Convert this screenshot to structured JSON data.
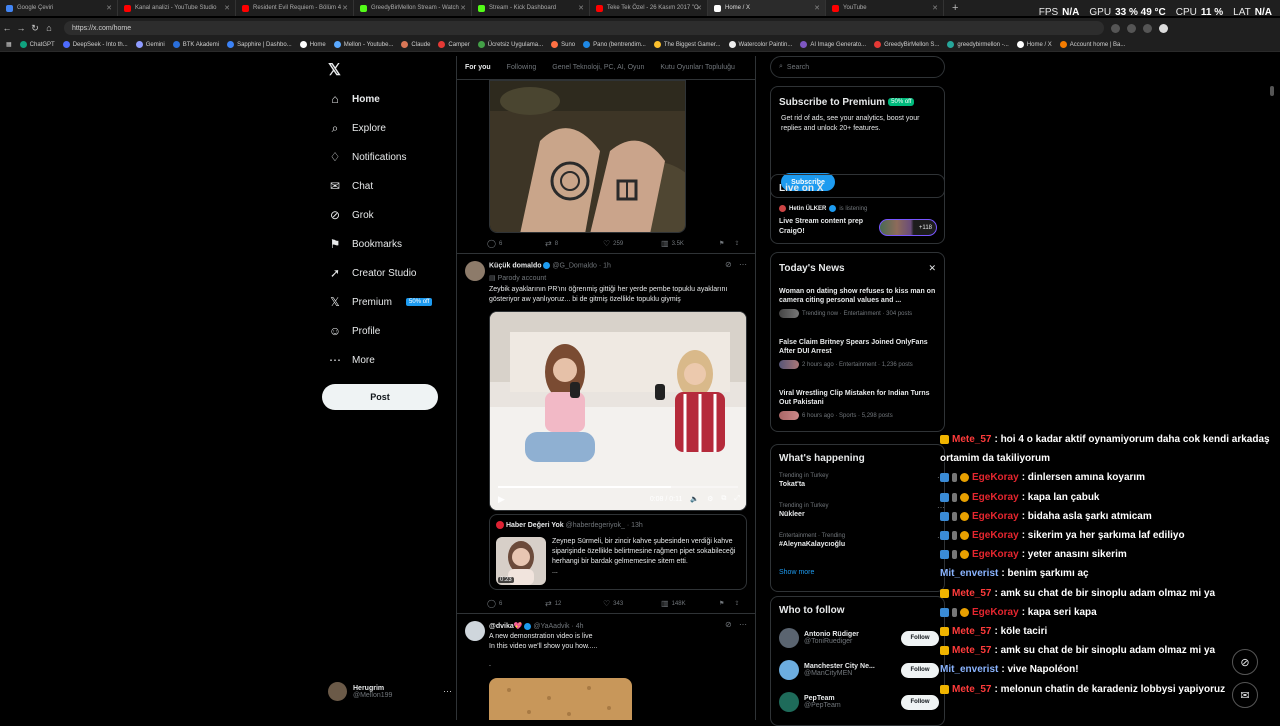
{
  "browser": {
    "tabs": [
      {
        "title": "Google Çeviri",
        "color": "#4285f4"
      },
      {
        "title": "Kanal analizi - YouTube Studio",
        "color": "#ff0000"
      },
      {
        "title": "Resident Evil Requiem - Bölüm 4",
        "color": "#ff0000"
      },
      {
        "title": "GreedyBirMellon Stream - Watch",
        "color": "#53fc18"
      },
      {
        "title": "Stream - Kick Dashboard",
        "color": "#53fc18"
      },
      {
        "title": "Teke Tek Özel - 26 Kasım 2017 \"O",
        "color": "#ff0000"
      },
      {
        "title": "Home / X",
        "color": "#ffffff"
      },
      {
        "title": "YouTube",
        "color": "#ff0000"
      }
    ],
    "url": "https://x.com/home",
    "bookmarks": [
      {
        "label": "ChatGPT",
        "color": "#10a37f"
      },
      {
        "label": "DeepSeek - Into th...",
        "color": "#4d6bfe"
      },
      {
        "label": "Gemini",
        "color": "#8e9bff"
      },
      {
        "label": "BTK Akademi",
        "color": "#2a6fdb"
      },
      {
        "label": "Sapphire | Dashbo...",
        "color": "#3b82f6"
      },
      {
        "label": "Home",
        "color": "#ffffff"
      },
      {
        "label": "Mellon - Youtube...",
        "color": "#5aa9ff"
      },
      {
        "label": "Claude",
        "color": "#d97757"
      },
      {
        "label": "Camper",
        "color": "#e53935"
      },
      {
        "label": "Ücretsiz Uygulama...",
        "color": "#43a047"
      },
      {
        "label": "Suno",
        "color": "#ff7043"
      },
      {
        "label": "Pano (bentrendim...",
        "color": "#1e88e5"
      },
      {
        "label": "The Biggest Gamer...",
        "color": "#fbc02d"
      },
      {
        "label": "Watercolor Paintin...",
        "color": "#eeeeee"
      },
      {
        "label": "AI Image Generato...",
        "color": "#7e57c2"
      },
      {
        "label": "GreedyBirMellon S...",
        "color": "#e53935"
      },
      {
        "label": "greedybirmellon -...",
        "color": "#26a69a"
      },
      {
        "label": "Home / X",
        "color": "#ffffff"
      },
      {
        "label": "Account home | Ba...",
        "color": "#f57c00"
      }
    ]
  },
  "overlay": {
    "fps_label": "FPS",
    "fps_value": "N/A",
    "gpu_label": "GPU",
    "gpu_value": "33 %  49 °C",
    "cpu_label": "CPU",
    "cpu_value": "11 %",
    "lat_label": "LAT",
    "lat_value": "N/A"
  },
  "sidebar": {
    "items": [
      {
        "label": "Home",
        "icon": "⌂"
      },
      {
        "label": "Explore",
        "icon": "⌕"
      },
      {
        "label": "Notifications",
        "icon": "♢"
      },
      {
        "label": "Chat",
        "icon": "✉"
      },
      {
        "label": "Grok",
        "icon": "⊘"
      },
      {
        "label": "Bookmarks",
        "icon": "⚑"
      },
      {
        "label": "Creator Studio",
        "icon": "➚"
      },
      {
        "label": "Premium",
        "icon": "𝕏"
      },
      {
        "label": "Profile",
        "icon": "☺"
      },
      {
        "label": "More",
        "icon": "⋯"
      }
    ],
    "premium_badge": "50% off",
    "post_label": "Post",
    "account": {
      "name": "Herugrim",
      "handle": "@Mellon199"
    }
  },
  "feed": {
    "tabs": [
      "For you",
      "Following",
      "Genel Teknoloji, PC, AI, Oyun",
      "Kutu Oyunları Topluluğu"
    ],
    "tweet1_stats": {
      "replies": "6",
      "reposts": "8",
      "likes": "259",
      "views": "3.5K"
    },
    "tweet2": {
      "name": "Küçük domaldo",
      "handle": "@G_Domaldo",
      "time": "1h",
      "parody": "Parody account",
      "text": "Zeybik ayaklarının PR'ını öğrenmiş gittiği her yerde pembe topuklu ayaklarını gösteriyor aw yanlıyoruz... bi de gitmiş özellikle topuklu giymiş",
      "video_time": "0:08 / 0:11",
      "video_progress": 0.72,
      "quote": {
        "name": "Haber Değeri Yok",
        "handle": "@haberdegeriyok_",
        "time": "13h",
        "text": "Zeynep Sürmeli, bir zincir kahve şubesinden verdiği kahve siparişinde özellikle belirtmesine rağmen pipet sokabileceği herhangi bir bardak gelmemesine sitem etti.",
        "ellipsis": "...",
        "duration": "0:23"
      },
      "stats": {
        "replies": "6",
        "reposts": "12",
        "likes": "343",
        "views": "148K"
      }
    },
    "tweet3": {
      "name": "@dvika💖",
      "handle": "@YaAadvik",
      "time": "4h",
      "text1": "A new demonstration video is live",
      "text2": "In this video we'll show you how.....",
      "text3": "."
    }
  },
  "right": {
    "search_placeholder": "Search",
    "premium": {
      "title": "Subscribe to Premium",
      "badge": "50% off",
      "text": "Get rid of ads, see your analytics, boost your replies and unlock 20+ features.",
      "button": "Subscribe"
    },
    "live": {
      "title": "Live on X",
      "host": "Hetin ÜLKER",
      "status": "is listening",
      "stream_title": "Live Stream content prep CraigO!",
      "count": "+118"
    },
    "news": {
      "title": "Today's News",
      "items": [
        {
          "title": "Woman on dating show refuses to kiss man on camera citing personal values and ...",
          "meta": "Trending now · Entertainment · 304 posts"
        },
        {
          "title": "False Claim Britney Spears Joined OnlyFans After DUI Arrest",
          "meta": "2 hours ago · Entertainment · 1,236 posts"
        },
        {
          "title": "Viral Wrestling Clip Mistaken for Indian Turns Out Pakistani",
          "meta": "6 hours ago · Sports · 5,298 posts"
        }
      ]
    },
    "happening": {
      "title": "What's happening",
      "trends": [
        {
          "category": "Trending in Turkey",
          "name": "Tokat'ta"
        },
        {
          "category": "Trending in Turkey",
          "name": "Nükleer"
        },
        {
          "category": "Entertainment · Trending",
          "name": "#AleynaKalaycıoğlu"
        }
      ],
      "show_more": "Show more"
    },
    "follow": {
      "title": "Who to follow",
      "items": [
        {
          "name": "Antonio Rüdiger",
          "handle": "@ToniRuediger",
          "button": "Follow"
        },
        {
          "name": "Manchester City Ne...",
          "handle": "@ManCityMEN",
          "button": "Follow"
        },
        {
          "name": "PepTeam",
          "handle": "@PepTeam",
          "button": "Follow"
        }
      ]
    }
  },
  "chat": {
    "lines": [
      {
        "user": "Mete_57",
        "msg": ": hoi 4 o kadar aktif oynamiyorum daha cok kendi arkadaş",
        "style": "red",
        "badges": [
          "y"
        ]
      },
      {
        "user": "",
        "msg": "ortamim da takiliyorum",
        "style": "none",
        "badges": []
      },
      {
        "user": "EgeKoray",
        "msg": ": dinlersen amına koyarım",
        "style": "red2",
        "badges": [
          "b",
          "s",
          "o"
        ]
      },
      {
        "user": "EgeKoray",
        "msg": ": kapa lan çabuk",
        "style": "red2",
        "badges": [
          "b",
          "s",
          "o"
        ]
      },
      {
        "user": "EgeKoray",
        "msg": ": bidaha asla şarkı atmicam",
        "style": "red2",
        "badges": [
          "b",
          "s",
          "o"
        ]
      },
      {
        "user": "EgeKoray",
        "msg": ": sikerim ya her şarkıma laf ediliyo",
        "style": "red2",
        "badges": [
          "b",
          "s",
          "o"
        ]
      },
      {
        "user": "EgeKoray",
        "msg": ": yeter anasını sikerim",
        "style": "red2",
        "badges": [
          "b",
          "s",
          "o"
        ]
      },
      {
        "user": "Mit_enverist",
        "msg": ": benim şarkımı aç",
        "style": "blue",
        "badges": []
      },
      {
        "user": "Mete_57",
        "msg": ": amk su chat de bir sinoplu adam olmaz mi ya",
        "style": "red",
        "badges": [
          "y"
        ]
      },
      {
        "user": "EgeKoray",
        "msg": ": kapa seri kapa",
        "style": "red2",
        "badges": [
          "b",
          "s",
          "o"
        ]
      },
      {
        "user": "Mete_57",
        "msg": ": köle taciri",
        "style": "red",
        "badges": [
          "y"
        ]
      },
      {
        "user": "Mete_57",
        "msg": ": amk su chat de bir sinoplu adam olmaz mi ya",
        "style": "red",
        "badges": [
          "y"
        ]
      },
      {
        "user": "Mit_enverist",
        "msg": ": vive Napoléon!",
        "style": "blue",
        "badges": []
      },
      {
        "user": "Mete_57",
        "msg": ": melonun chatin de karadeniz lobbysi yapiyoruz",
        "style": "red",
        "badges": [
          "y"
        ]
      }
    ]
  }
}
